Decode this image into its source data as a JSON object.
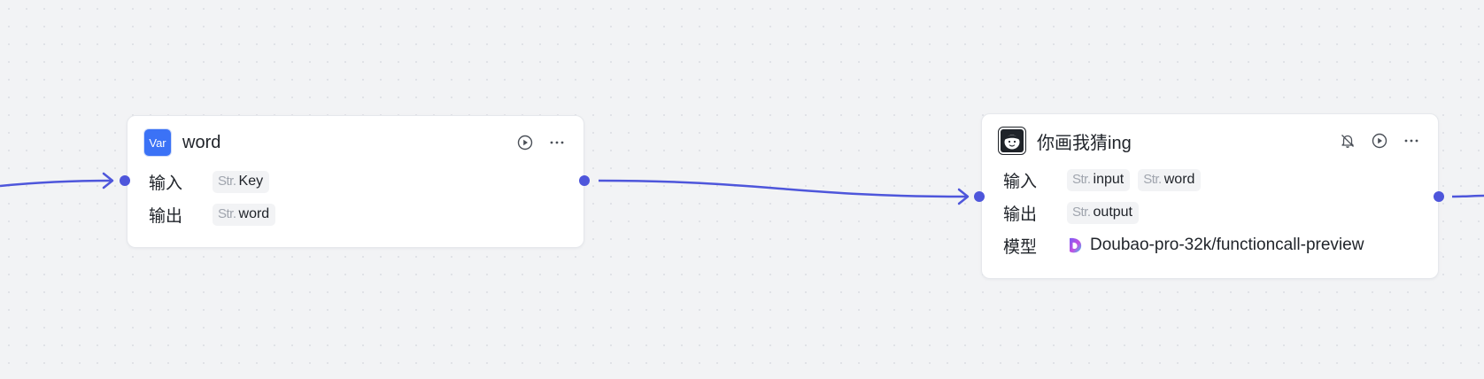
{
  "nodes": {
    "variable": {
      "icon_text": "Var",
      "title": "word",
      "input_label": "输入",
      "output_label": "输出",
      "inputs": [
        {
          "type": "Str.",
          "name": "Key"
        }
      ],
      "outputs": [
        {
          "type": "Str.",
          "name": "word"
        }
      ],
      "actions": [
        "play-icon",
        "more-icon"
      ]
    },
    "llm": {
      "icon": "face-avatar-icon",
      "title": "你画我猜ing",
      "input_label": "输入",
      "output_label": "输出",
      "model_label": "模型",
      "inputs": [
        {
          "type": "Str.",
          "name": "input"
        },
        {
          "type": "Str.",
          "name": "word"
        }
      ],
      "outputs": [
        {
          "type": "Str.",
          "name": "output"
        }
      ],
      "model": "Doubao-pro-32k/functioncall-preview",
      "actions": [
        "bell-off-icon",
        "play-icon",
        "more-icon"
      ]
    }
  },
  "colors": {
    "edge": "#4e56db",
    "var_icon_bg": "#3b72f6",
    "canvas_bg": "#f2f3f5"
  }
}
